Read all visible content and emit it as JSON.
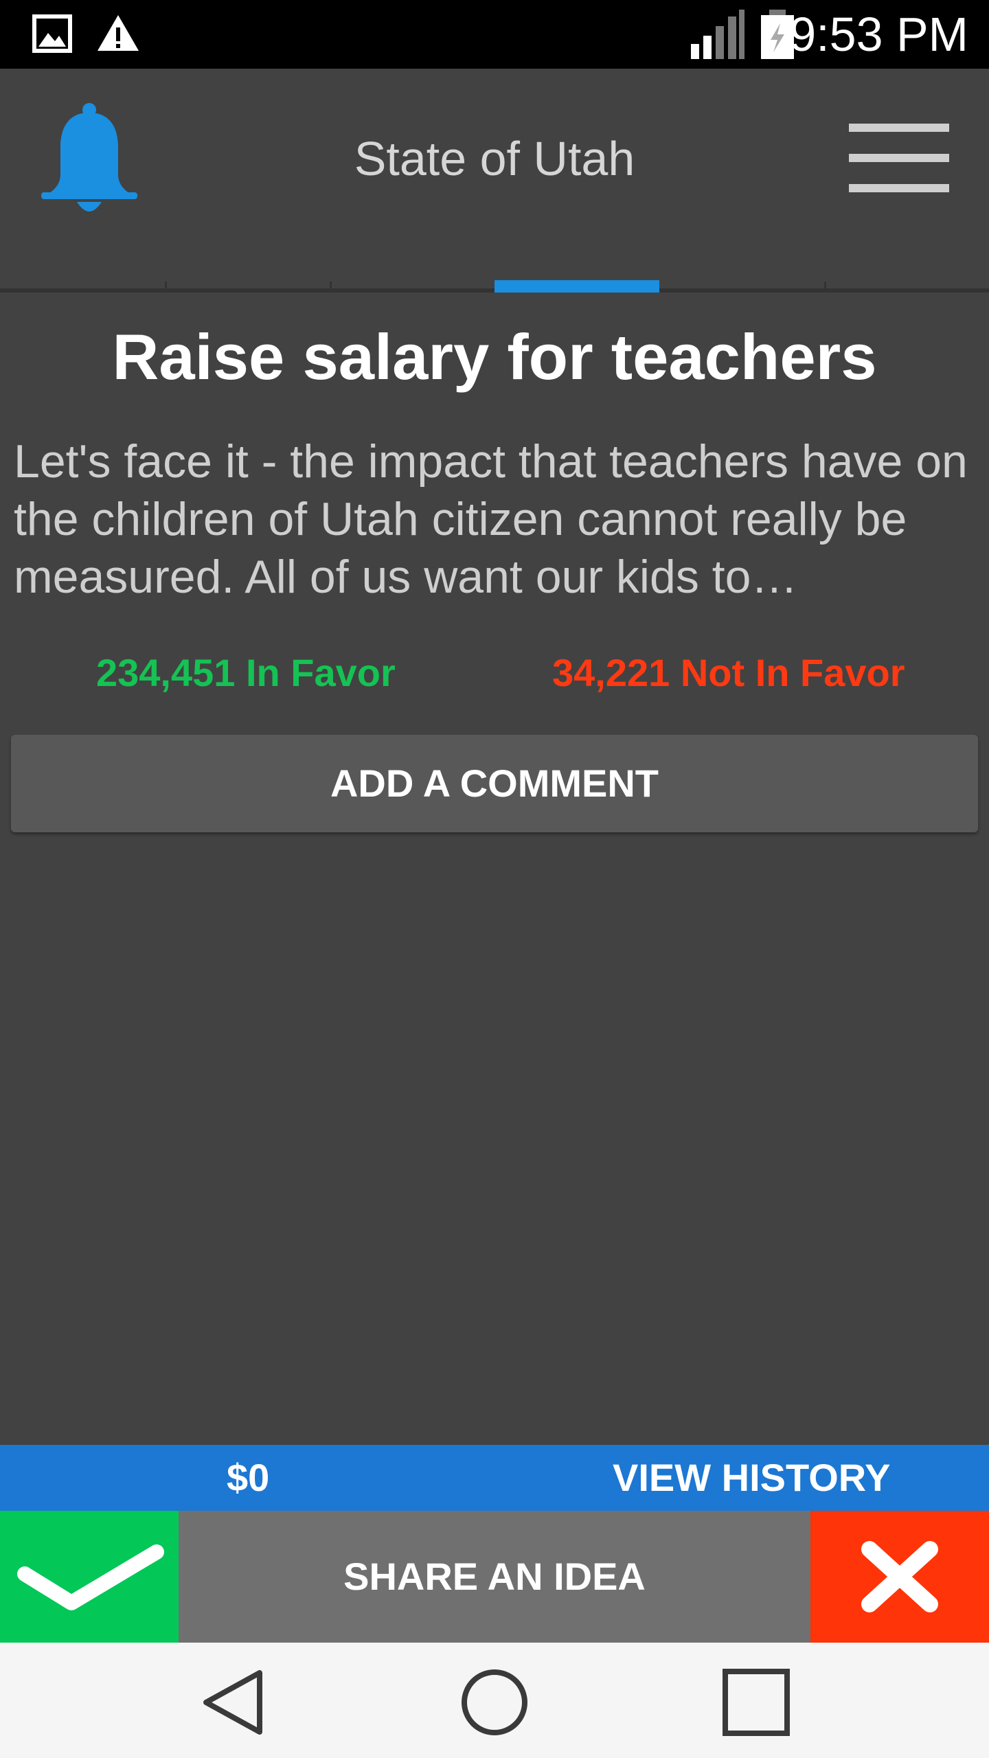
{
  "status_bar": {
    "time": "9:53 PM",
    "icons": [
      "image-icon",
      "warning-icon",
      "signal-icon",
      "battery-charging-icon"
    ]
  },
  "app_bar": {
    "title": "State of Utah",
    "left_icon": "bell-icon",
    "right_icon": "menu-icon"
  },
  "tabs": {
    "count": 6,
    "active_index": 3,
    "accent_color": "#1b8fe0"
  },
  "idea": {
    "title": "Raise salary for teachers",
    "description": "Let's face it - the impact that teachers have on the children of Utah citizen cannot really be measured. All of us want our kids to…",
    "in_favor": "234,451 In Favor",
    "not_in_favor": "34,221 Not In Favor"
  },
  "colors": {
    "favor": "#15c254",
    "not_favor": "#ff3a13",
    "blue_bar": "#1c78d2",
    "approve": "#03c757",
    "reject": "#ff3408"
  },
  "comment_button": {
    "label": "ADD A COMMENT"
  },
  "balance_bar": {
    "balance": "$0",
    "history_label": "VIEW HISTORY"
  },
  "action_bar": {
    "share_label": "SHARE AN IDEA",
    "approve_icon": "checkmark-icon",
    "reject_icon": "close-icon"
  },
  "nav_bar": {
    "icons": [
      "back-icon",
      "home-icon",
      "recents-icon"
    ]
  }
}
